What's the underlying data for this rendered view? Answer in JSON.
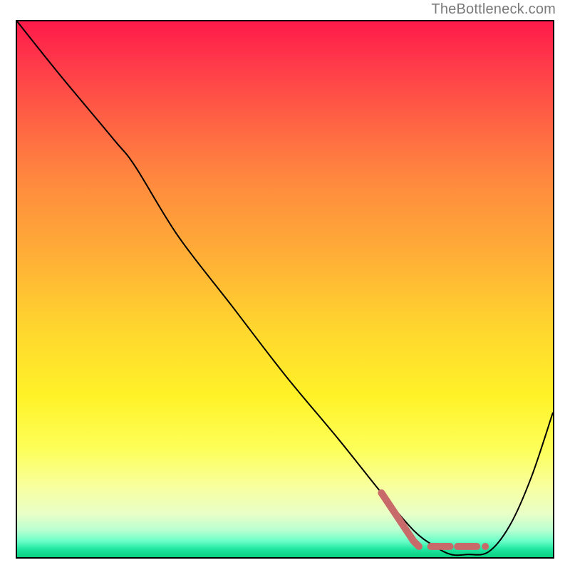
{
  "attribution": "TheBottleneck.com",
  "colors": {
    "frame_border": "#000000",
    "curve_stroke": "#000000",
    "dash_stroke": "#c96a6a",
    "gradient_top": "#ff1a4a",
    "gradient_bottom": "#0ad080"
  },
  "chart_data": {
    "type": "line",
    "title": "",
    "xlabel": "",
    "ylabel": "",
    "xlim": [
      0,
      100
    ],
    "ylim": [
      0,
      100
    ],
    "grid": false,
    "legend": false,
    "series": [
      {
        "name": "bottleneck-curve",
        "x": [
          0,
          8,
          18,
          22,
          30,
          40,
          50,
          60,
          68,
          74,
          78,
          81,
          84,
          88,
          92,
          96,
          100
        ],
        "y": [
          100,
          90,
          78,
          73,
          60,
          47,
          34,
          22,
          12,
          5,
          2,
          0.5,
          0.5,
          1,
          6,
          15,
          27
        ]
      }
    ],
    "highlight_segment": {
      "name": "optimal-range-marker",
      "points": [
        {
          "x": 68,
          "y": 12
        },
        {
          "x": 72,
          "y": 6
        },
        {
          "x": 74,
          "y": 3
        },
        {
          "x": 75,
          "y": 2
        },
        {
          "x": 78,
          "y": 2
        },
        {
          "x": 80,
          "y": 2
        },
        {
          "x": 83,
          "y": 2
        },
        {
          "x": 85,
          "y": 2
        }
      ],
      "style": "dashed-thick"
    }
  }
}
